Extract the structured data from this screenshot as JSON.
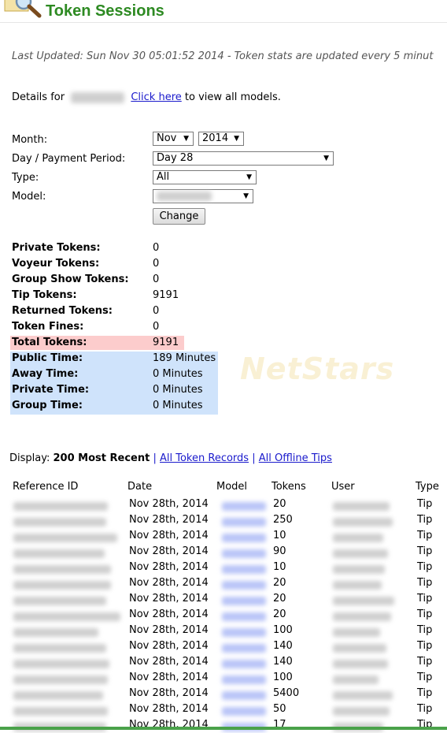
{
  "header": {
    "title": "Token Sessions",
    "logo_icon": "magnifier-icon"
  },
  "last_updated": "Last Updated: Sun Nov 30 05:01:52 2014 - Token stats are updated every 5 minut",
  "details": {
    "prefix": "Details for",
    "link": "Click here",
    "suffix": "to view all models."
  },
  "form": {
    "month_label": "Month:",
    "month_value": "Nov",
    "year_value": "2014",
    "day_label": "Day / Payment Period:",
    "day_value": "Day 28",
    "type_label": "Type:",
    "type_value": "All",
    "model_label": "Model:",
    "change_button": "Change"
  },
  "stats": [
    {
      "label": "Private Tokens:",
      "value": "0"
    },
    {
      "label": "Voyeur Tokens:",
      "value": "0"
    },
    {
      "label": "Group Show Tokens:",
      "value": "0"
    },
    {
      "label": "Tip Tokens:",
      "value": "9191"
    },
    {
      "label": "Returned Tokens:",
      "value": "0"
    },
    {
      "label": "Token Fines:",
      "value": "0"
    },
    {
      "label": "Total Tokens:",
      "value": "9191"
    },
    {
      "label": "Public Time:",
      "value": "189 Minutes"
    },
    {
      "label": "Away Time:",
      "value": "0 Minutes"
    },
    {
      "label": "Private Time:",
      "value": "0 Minutes"
    },
    {
      "label": "Group Time:",
      "value": "0 Minutes"
    }
  ],
  "watermark": "NetStars",
  "display": {
    "label": "Display:",
    "current": "200 Most Recent",
    "sep": "|",
    "link1": "All Token Records",
    "link2": "All Offline Tips"
  },
  "table": {
    "headers": [
      "Reference ID",
      "Date",
      "Model",
      "Tokens",
      "User",
      "Type"
    ],
    "rows": [
      {
        "date": "Nov 28th, 2014",
        "tokens": "20",
        "type": "Tip"
      },
      {
        "date": "Nov 28th, 2014",
        "tokens": "250",
        "type": "Tip"
      },
      {
        "date": "Nov 28th, 2014",
        "tokens": "10",
        "type": "Tip"
      },
      {
        "date": "Nov 28th, 2014",
        "tokens": "90",
        "type": "Tip"
      },
      {
        "date": "Nov 28th, 2014",
        "tokens": "10",
        "type": "Tip"
      },
      {
        "date": "Nov 28th, 2014",
        "tokens": "20",
        "type": "Tip"
      },
      {
        "date": "Nov 28th, 2014",
        "tokens": "20",
        "type": "Tip"
      },
      {
        "date": "Nov 28th, 2014",
        "tokens": "20",
        "type": "Tip"
      },
      {
        "date": "Nov 28th, 2014",
        "tokens": "100",
        "type": "Tip"
      },
      {
        "date": "Nov 28th, 2014",
        "tokens": "140",
        "type": "Tip"
      },
      {
        "date": "Nov 28th, 2014",
        "tokens": "140",
        "type": "Tip"
      },
      {
        "date": "Nov 28th, 2014",
        "tokens": "100",
        "type": "Tip"
      },
      {
        "date": "Nov 28th, 2014",
        "tokens": "5400",
        "type": "Tip"
      },
      {
        "date": "Nov 28th, 2014",
        "tokens": "50",
        "type": "Tip"
      },
      {
        "date": "Nov 28th, 2014",
        "tokens": "17",
        "type": "Tip"
      }
    ]
  },
  "colors": {
    "title": "#2d8a22",
    "link": "#1a1acc",
    "total_highlight": "#fccccc",
    "time_highlight": "#cfe3fb",
    "model_blur": "#b9c4f7"
  }
}
